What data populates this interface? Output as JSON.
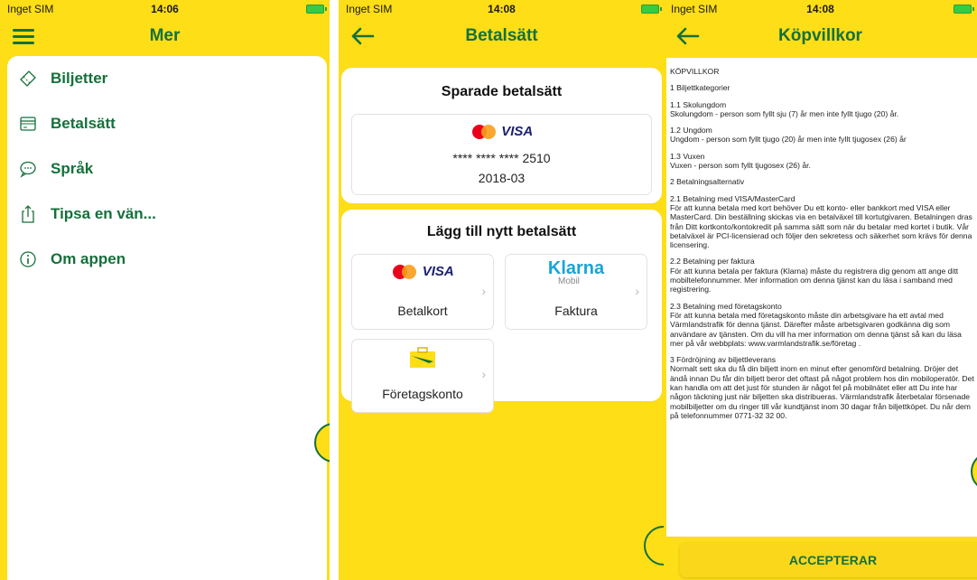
{
  "colors": {
    "brand_yellow": "#fdde17",
    "brand_green": "#15703b"
  },
  "screen1": {
    "status": {
      "carrier": "Inget SIM",
      "time": "14:06"
    },
    "title": "Mer",
    "menu": [
      {
        "label": "Biljetter",
        "icon": "ticket-icon"
      },
      {
        "label": "Betalsätt",
        "icon": "card-icon"
      },
      {
        "label": "Språk",
        "icon": "chat-bubble-icon"
      },
      {
        "label": "Tipsa en vän...",
        "icon": "share-icon"
      },
      {
        "label": "Om appen",
        "icon": "info-icon"
      }
    ]
  },
  "screen2": {
    "status": {
      "carrier": "Inget SIM",
      "time": "14:08"
    },
    "title": "Betalsätt",
    "saved": {
      "heading": "Sparade betalsätt",
      "brand": "VISA",
      "card_number": "**** **** **** 2510",
      "expiry": "2018-03"
    },
    "add": {
      "heading": "Lägg till nytt betalsätt",
      "options": [
        {
          "label": "Betalkort",
          "logo": "VISA"
        },
        {
          "label": "Faktura",
          "logo": "Klarna",
          "sublogo": "Mobil"
        },
        {
          "label": "Företagskonto",
          "logo": "briefcase-icon"
        }
      ]
    }
  },
  "screen3": {
    "status": {
      "carrier": "Inget SIM",
      "time": "14:08"
    },
    "title": "Köpvillkor",
    "terms": [
      "KÖPVILLKOR",
      "1 Biljettkategorier",
      "1.1 Skolungdom\nSkolungdom - person som fyllt sju (7) år men inte fyllt tjugo (20) år.",
      "1.2 Ungdom\nUngdom - person som fyllt tjugo (20) år men inte fyllt tjugosex (26) år",
      "1.3 Vuxen\nVuxen - person som fyllt tjugosex (26) år.",
      "",
      "2 Betalningsalternativ",
      "2.1 Betalning med VISA/MasterCard\nFör att kunna betala med kort behöver Du ett konto- eller bankkort med VISA eller MasterCard. Din beställning skickas via en betalväxel till kortutgivaren. Betalningen dras från Ditt kortkonto/kontokredit på samma sätt som när du betalar med kortet i butik. Vår betalväxel är PCI-licensierad och följer den sekretess och säkerhet som krävs för denna licensering.",
      "2.2 Betalning per faktura\nFör att kunna betala per faktura (Klarna) måste du registrera dig genom att ange ditt mobiltelefonnummer. Mer information om denna tjänst kan du läsa i samband med registrering.",
      "2.3 Betalning med företagskonto\nFör att kunna betala med företagskonto måste din arbetsgivare ha ett avtal med Värmlandstrafik för denna tjänst. Därefter måste arbetsgivaren godkänna dig som användare av tjänsten. Om du vill ha mer information om denna tjänst så kan du läsa mer på vår webbplats: www.varmlandstrafik.se/företag .",
      "",
      "3 Fördröjning av biljettleverans\nNormalt sett ska du få din biljett inom en minut efter genomförd betalning. Dröjer det ändå innan Du får din biljett beror det oftast på något problem hos din mobiloperatör. Det kan handla om att det just för stunden är något fel på mobilnätet eller att Du inte har någon täckning just när biljetten ska distribueras. Värmlandstrafik återbetalar försenade mobilbiljetter om du ringer till vår kundtjänst inom 30 dagar från biljettköpet. Du når dem på telefonnummer 0771-32 32 00."
    ],
    "accept_label": "ACCEPTERAR"
  }
}
